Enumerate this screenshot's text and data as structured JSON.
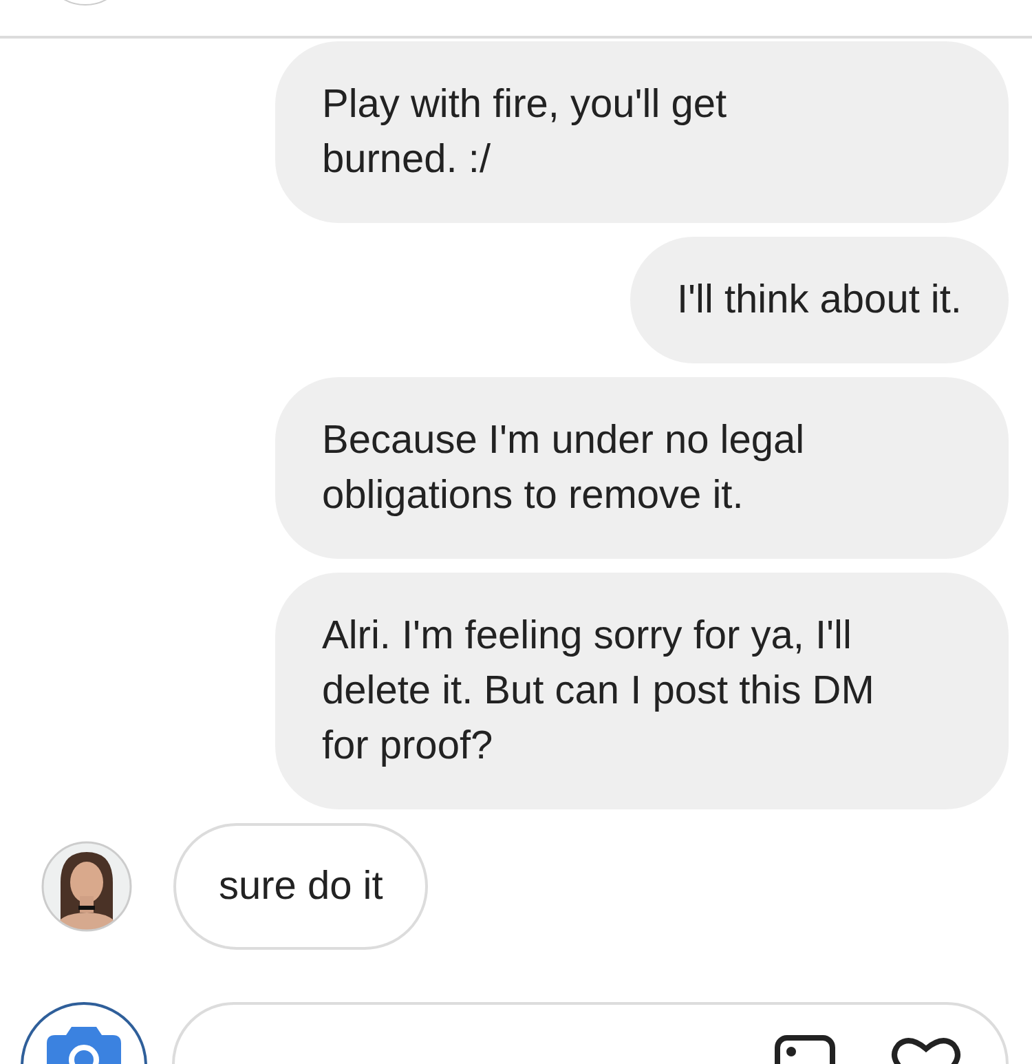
{
  "messages": [
    {
      "kind": "sent",
      "text": "Play with fire, you'll get\nburned. :/"
    },
    {
      "kind": "sent",
      "text": "I'll think about it."
    },
    {
      "kind": "sent",
      "text": "Because I'm under no legal\nobligations to remove it."
    },
    {
      "kind": "sent",
      "text": "Alri. I'm feeling sorry for ya, I'll\ndelete it. But can I post this DM\nfor proof?"
    },
    {
      "kind": "received",
      "text": "sure do it"
    }
  ]
}
